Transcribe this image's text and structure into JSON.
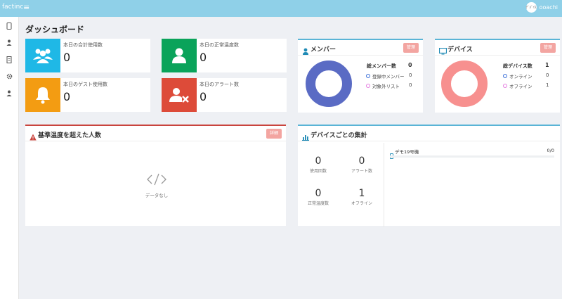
{
  "app": {
    "brand": "factinc",
    "username": "ooachi",
    "avatar_text": "ﾃﾞﾊﾞｲｽ"
  },
  "sidebar": {
    "icons": [
      "mobile-icon",
      "user-icon",
      "document-icon",
      "gear-icon",
      "user-icon"
    ]
  },
  "page": {
    "title": "ダッシュボード"
  },
  "stats": [
    {
      "label": "本日の合計使用数",
      "value": "0",
      "color": "#1fb8e6"
    },
    {
      "label": "本日の正常温度数",
      "value": "0",
      "color": "#0aa35a"
    },
    {
      "label": "本日のゲスト使用数",
      "value": "0",
      "color": "#f39c12"
    },
    {
      "label": "本日のアラート数",
      "value": "0",
      "color": "#dd4b39"
    }
  ],
  "members": {
    "title": "メンバー",
    "button": "管理",
    "total_label": "総メンバー数",
    "total_value": "0",
    "rows": [
      {
        "label": "登録中メンバー",
        "value": "0"
      },
      {
        "label": "対象外リスト",
        "value": "0"
      }
    ],
    "donut_color": "#5a6bc4"
  },
  "devices": {
    "title": "デバイス",
    "button": "管理",
    "total_label": "総デバイス数",
    "total_value": "1",
    "rows": [
      {
        "label": "オンライン",
        "value": "0"
      },
      {
        "label": "オフライン",
        "value": "1"
      }
    ],
    "donut_color": "#f7908f"
  },
  "temp_panel": {
    "title": "基準温度を超えた人数",
    "button": "詳細",
    "empty_text": "データなし"
  },
  "device_summary": {
    "title": "デバイスごとの集計",
    "stats": [
      {
        "value": "0",
        "label": "使用回数"
      },
      {
        "value": "0",
        "label": "アラート数"
      },
      {
        "value": "0",
        "label": "正常温度数"
      },
      {
        "value": "1",
        "label": "オフライン"
      }
    ],
    "device_name": "デモ19号機",
    "device_ratio": "0/0"
  }
}
